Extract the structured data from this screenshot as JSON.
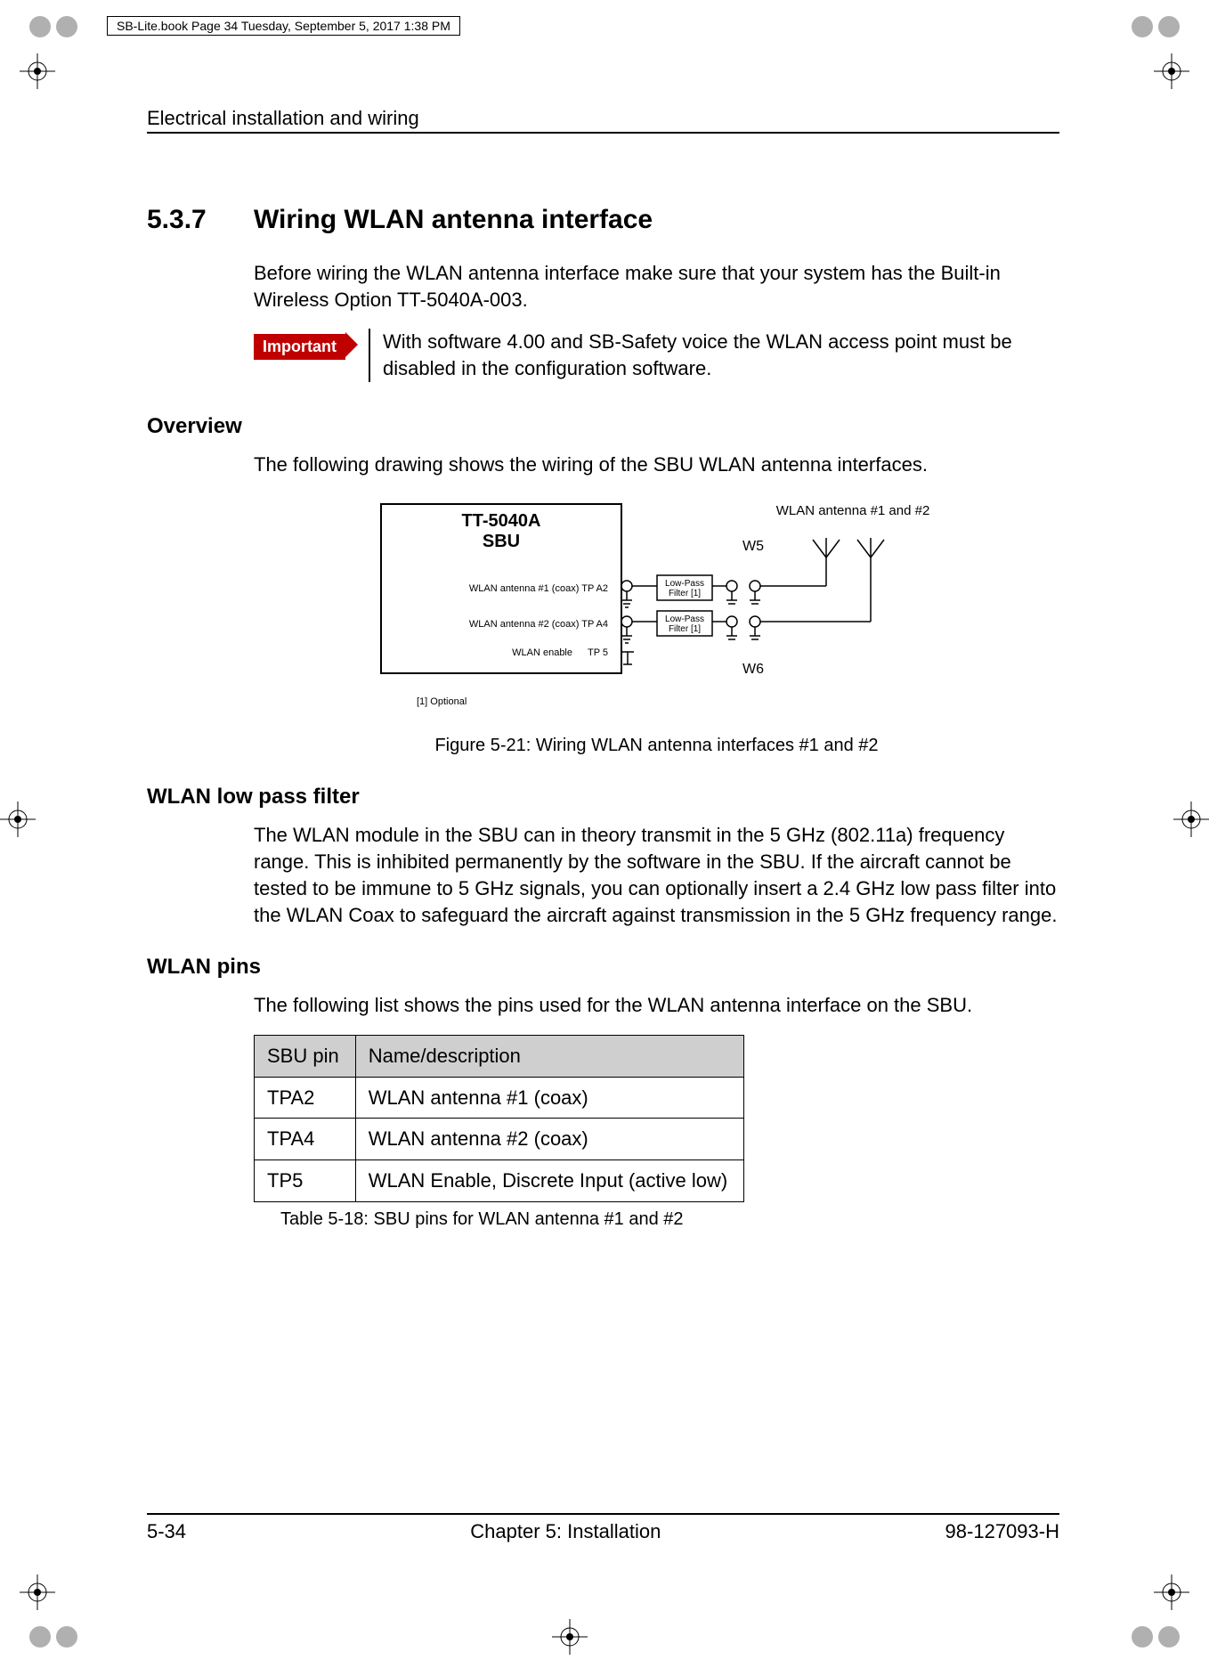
{
  "print_meta": "SB-Lite.book  Page 34  Tuesday, September 5, 2017  1:38 PM",
  "running_head": "Electrical installation and wiring",
  "section": {
    "number": "5.3.7",
    "title": "Wiring WLAN antenna interface",
    "intro": "Before wiring the WLAN antenna interface make sure that your system has the Built-in Wireless Option TT-5040A-003.",
    "important_label": "Important",
    "important_text": "With software 4.00 and SB-Safety voice the WLAN access point must be disabled in the configuration software."
  },
  "overview": {
    "heading": "Overview",
    "text": "The following drawing shows the wiring of the SBU WLAN antenna interfaces.",
    "figure_caption": "Figure 5-21: Wiring WLAN antenna interfaces #1 and #2"
  },
  "diagram": {
    "device_title_l1": "TT-5040A",
    "device_title_l2": "SBU",
    "ant_label": "WLAN antenna #1 and #2",
    "w5": "W5",
    "w6": "W6",
    "port1": "WLAN antenna #1 (coax) TP A2",
    "port2": "WLAN antenna #2 (coax) TP A4",
    "enable": "WLAN enable",
    "enable_pin": "TP 5",
    "filter_l1": "Low-Pass",
    "filter_l2": "Filter [1]",
    "footnote": "[1]  Optional"
  },
  "lowpass": {
    "heading": "WLAN low pass filter",
    "text": "The WLAN module in the SBU can in theory transmit in the 5 GHz (802.11a) frequency range. This is inhibited permanently by the software in the SBU. If the aircraft cannot be tested to be immune to 5 GHz signals, you can optionally insert a 2.4 GHz low pass filter into the WLAN Coax to safeguard the aircraft against transmission in the 5 GHz frequency range."
  },
  "pins": {
    "heading": "WLAN pins",
    "intro": "The following list shows the pins used for the WLAN antenna interface on the SBU.",
    "col1": "SBU pin",
    "col2": "Name/description",
    "rows": [
      {
        "pin": "TPA2",
        "desc": "WLAN antenna #1 (coax)"
      },
      {
        "pin": "TPA4",
        "desc": "WLAN antenna #2 (coax)"
      },
      {
        "pin": "TP5",
        "desc": "WLAN Enable, Discrete Input (active low)"
      }
    ],
    "caption": "Table 5-18: SBU pins for WLAN antenna #1 and #2"
  },
  "footer": {
    "left": "5-34",
    "center": "Chapter 5:  Installation",
    "right": "98-127093-H"
  }
}
